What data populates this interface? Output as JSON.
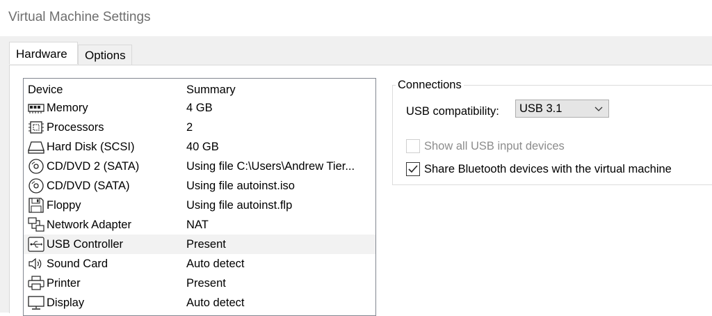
{
  "window": {
    "title": "Virtual Machine Settings"
  },
  "tabs": [
    {
      "label": "Hardware",
      "active": true
    },
    {
      "label": "Options",
      "active": false
    }
  ],
  "device_list": {
    "headers": {
      "device": "Device",
      "summary": "Summary"
    },
    "rows": [
      {
        "icon": "memory-icon",
        "name": "Memory",
        "summary": "4 GB"
      },
      {
        "icon": "processor-icon",
        "name": "Processors",
        "summary": "2"
      },
      {
        "icon": "hard-disk-icon",
        "name": "Hard Disk (SCSI)",
        "summary": "40 GB"
      },
      {
        "icon": "cd-dvd-icon",
        "name": "CD/DVD 2 (SATA)",
        "summary": "Using file C:\\Users\\Andrew Tier..."
      },
      {
        "icon": "cd-dvd-icon",
        "name": "CD/DVD (SATA)",
        "summary": "Using file autoinst.iso"
      },
      {
        "icon": "floppy-icon",
        "name": "Floppy",
        "summary": "Using file autoinst.flp"
      },
      {
        "icon": "network-adapter-icon",
        "name": "Network Adapter",
        "summary": "NAT"
      },
      {
        "icon": "usb-icon",
        "name": "USB Controller",
        "summary": "Present",
        "selected": true
      },
      {
        "icon": "speaker-icon",
        "name": "Sound Card",
        "summary": "Auto detect"
      },
      {
        "icon": "printer-icon",
        "name": "Printer",
        "summary": "Present"
      },
      {
        "icon": "display-icon",
        "name": "Display",
        "summary": "Auto detect"
      }
    ]
  },
  "connections": {
    "legend": "Connections",
    "usb_compat_label": "USB compatibility:",
    "usb_compat_value": "USB 3.1",
    "show_all_usb": {
      "label": "Show all USB input devices",
      "checked": false,
      "enabled": false
    },
    "share_bluetooth": {
      "label": "Share Bluetooth devices with the virtual machine",
      "checked": true,
      "enabled": true
    }
  }
}
